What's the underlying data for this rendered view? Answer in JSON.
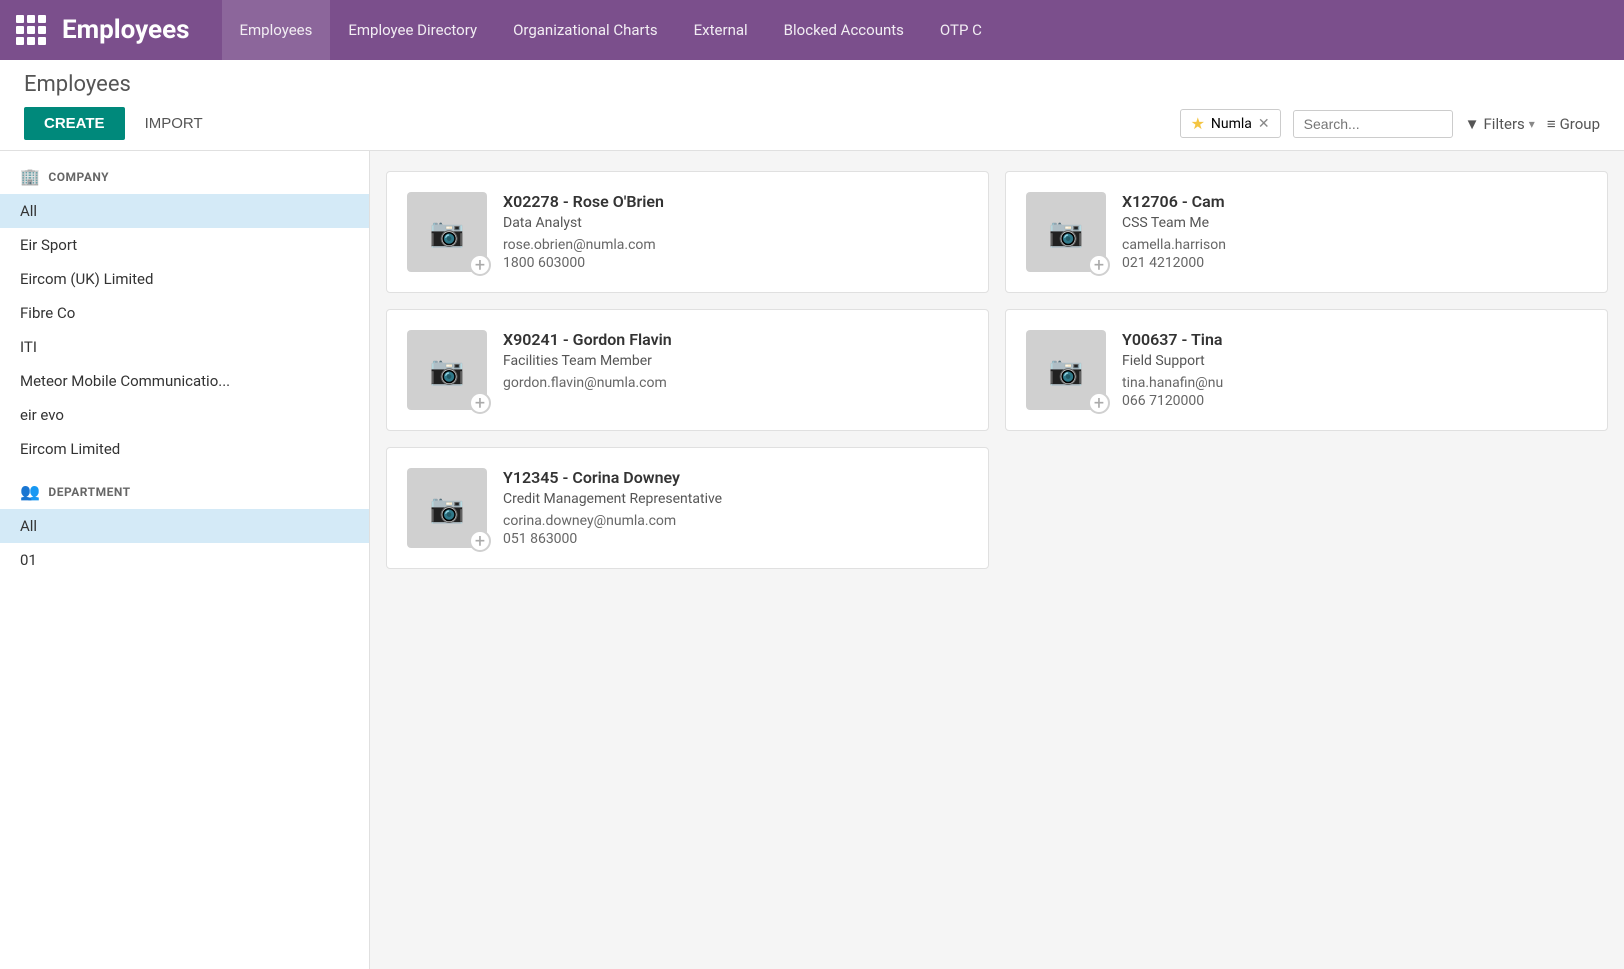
{
  "nav": {
    "grid_icon": "grid",
    "app_title": "Employees",
    "links": [
      {
        "label": "Employees",
        "active": true
      },
      {
        "label": "Employee Directory",
        "active": false
      },
      {
        "label": "Organizational Charts",
        "active": false
      },
      {
        "label": "External",
        "active": false
      },
      {
        "label": "Blocked Accounts",
        "active": false
      },
      {
        "label": "OTP C",
        "active": false
      }
    ]
  },
  "subheader": {
    "page_title": "Employees",
    "create_label": "CREATE",
    "import_label": "IMPORT",
    "favorite_label": "Numla",
    "search_placeholder": "Search...",
    "filters_label": "Filters",
    "group_label": "Group"
  },
  "sidebar": {
    "company_section_label": "COMPANY",
    "company_section_icon": "🏢",
    "company_items": [
      {
        "label": "All",
        "active": true
      },
      {
        "label": "Eir Sport",
        "active": false
      },
      {
        "label": "Eircom (UK) Limited",
        "active": false
      },
      {
        "label": "Fibre Co",
        "active": false
      },
      {
        "label": "ITI",
        "active": false
      },
      {
        "label": "Meteor Mobile Communicatio...",
        "active": false
      },
      {
        "label": "eir evo",
        "active": false
      },
      {
        "label": "Eircom Limited",
        "active": false
      }
    ],
    "department_section_label": "DEPARTMENT",
    "department_section_icon": "👥",
    "department_items": [
      {
        "label": "All",
        "active": true
      },
      {
        "label": "01",
        "active": false
      }
    ]
  },
  "employees": [
    {
      "id": "X02278",
      "name": "X02278 - Rose O'Brien",
      "role": "Data Analyst",
      "email": "rose.obrien@numla.com",
      "phone": "1800 603000"
    },
    {
      "id": "X12706",
      "name": "X12706 - Cam",
      "role": "CSS Team Me",
      "email": "camella.harrison",
      "phone": "021 4212000"
    },
    {
      "id": "X90241",
      "name": "X90241 - Gordon Flavin",
      "role": "Facilities Team Member",
      "email": "gordon.flavin@numla.com",
      "phone": ""
    },
    {
      "id": "Y00637",
      "name": "Y00637 - Tina",
      "role": "Field Support",
      "email": "tina.hanafin@nu",
      "phone": "066 7120000"
    },
    {
      "id": "Y12345",
      "name": "Y12345 - Corina Downey",
      "role": "Credit Management Representative",
      "email": "corina.downey@numla.com",
      "phone": "051 863000"
    }
  ],
  "colors": {
    "nav_bg": "#7b4f8c",
    "create_btn": "#00897b",
    "active_filter": "#d4eaf7"
  }
}
